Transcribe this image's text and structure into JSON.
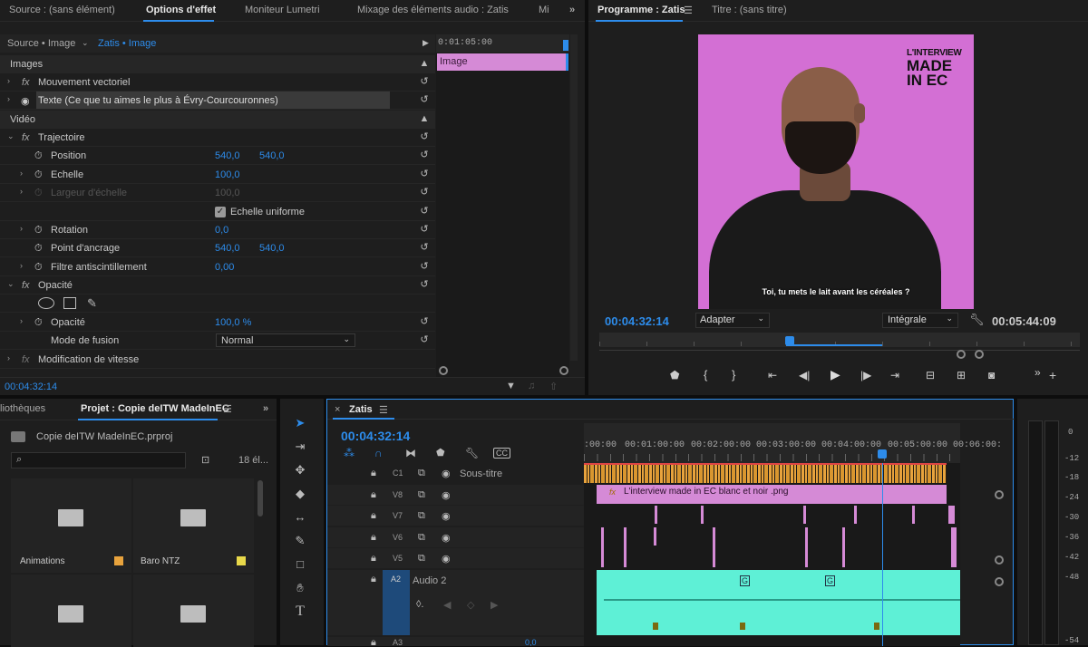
{
  "top_tabs": {
    "source": "Source : (sans élément)",
    "effect_options": "Options d'effet",
    "lumetri": "Moniteur Lumetri",
    "audio_mix": "Mixage des éléments audio : Zatis",
    "more": "Mi"
  },
  "effects": {
    "source_label": "Source • Image",
    "sequence_label": "Zatis • Image",
    "mini_timecode": "0:01:05:00",
    "clip_label": "Image",
    "section_images": "Images",
    "section_video": "Vidéo",
    "vector_motion": "Mouvement vectoriel",
    "text_layer": "Texte (Ce que tu aimes le plus à Évry-Courcouronnes)",
    "trajectory": "Trajectoire",
    "position_label": "Position",
    "position_x": "540,0",
    "position_y": "540,0",
    "scale_label": "Echelle",
    "scale_value": "100,0",
    "scale_width_label": "Largeur d'échelle",
    "scale_width_value": "100,0",
    "uniform_scale_label": "Echelle uniforme",
    "uniform_scale_checked": true,
    "rotation_label": "Rotation",
    "rotation_value": "0,0",
    "anchor_label": "Point d'ancrage",
    "anchor_x": "540,0",
    "anchor_y": "540,0",
    "antiflicker_label": "Filtre antiscintillement",
    "antiflicker_value": "0,00",
    "opacity_section": "Opacité",
    "opacity_label": "Opacité",
    "opacity_value": "100,0 %",
    "blend_label": "Mode de fusion",
    "blend_value": "Normal",
    "speed_label": "Modification de vitesse",
    "footer_timecode": "00:04:32:14"
  },
  "program": {
    "tab_program": "Programme : Zatis",
    "tab_title": "Titre : (sans titre)",
    "logo_line1": "L'INTERVIEW",
    "logo_line2": "MADE",
    "logo_line3": "IN EC",
    "subtitle": "Toi, tu mets le lait avant les céréales ?",
    "timecode": "00:04:32:14",
    "fit_value": "Adapter",
    "quality_value": "Intégrale",
    "duration": "00:05:44:09",
    "playhead_fraction": 0.79
  },
  "project": {
    "tab_libraries": "liothèques",
    "tab_project": "Projet : Copie deITW MadeInEC",
    "file_name": "Copie deITW MadeInEC.prproj",
    "item_count": "18 él...",
    "bins": [
      {
        "name": "Animations",
        "color": "#e8a33d"
      },
      {
        "name": "Baro NTZ",
        "color": "#e8d84a"
      },
      {
        "name": "",
        "color": ""
      },
      {
        "name": "",
        "color": ""
      }
    ]
  },
  "timeline": {
    "tab": "Zatis",
    "timecode": "00:04:32:14",
    "ruler": [
      ":00:00",
      "00:01:00:00",
      "00:02:00:00",
      "00:03:00:00",
      "00:04:00:00",
      "00:05:00:00",
      "00:06:00:"
    ],
    "tracks": {
      "c1": "C1",
      "c1_name": "Sous-titre",
      "v8": "V8",
      "v7": "V7",
      "v6": "V6",
      "v5": "V5",
      "a2": "A2",
      "a2_name": "Audio 2",
      "a3": "A3",
      "a3_level": "0,0"
    },
    "v8_clip": "L'interview made in EC  blanc et noir .png",
    "audio_markers": [
      "G",
      "G",
      "G"
    ]
  },
  "meter": {
    "scale": [
      "0",
      "-12",
      "-18",
      "-24",
      "-30",
      "-36",
      "-42",
      "-48",
      "-54"
    ]
  },
  "colors": {
    "accent": "#2d8ceb",
    "video_clip": "#d58ad6",
    "caption_clip": "#e8a33d",
    "audio_clip": "#5ef0d6",
    "frame_bg": "#d36fd4"
  }
}
